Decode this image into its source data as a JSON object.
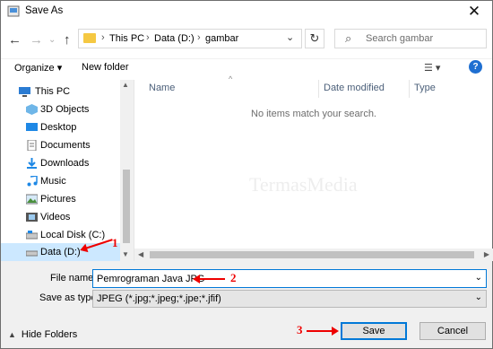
{
  "window": {
    "title": "Save As",
    "close_symbol": "✕"
  },
  "nav": {
    "back": "←",
    "forward": "→",
    "recent": "⌄",
    "up": "↑",
    "path": [
      "This PC",
      "Data (D:)",
      "gambar"
    ],
    "separator": "›",
    "refresh": "↻",
    "search_placeholder": "Search gambar"
  },
  "toolbar": {
    "organize": "Organize ▾",
    "new_folder": "New folder",
    "view": "☰ ▾",
    "help": "?"
  },
  "tree": [
    {
      "label": "This PC",
      "icon": "pc-icon"
    },
    {
      "label": "3D Objects",
      "icon": "3d-objects-icon"
    },
    {
      "label": "Desktop",
      "icon": "desktop-icon"
    },
    {
      "label": "Documents",
      "icon": "documents-icon"
    },
    {
      "label": "Downloads",
      "icon": "downloads-icon"
    },
    {
      "label": "Music",
      "icon": "music-icon"
    },
    {
      "label": "Pictures",
      "icon": "pictures-icon"
    },
    {
      "label": "Videos",
      "icon": "videos-icon"
    },
    {
      "label": "Local Disk (C:)",
      "icon": "drive-icon"
    },
    {
      "label": "Data (D:)",
      "icon": "drive-icon",
      "selected": true
    }
  ],
  "columns": [
    "Name",
    "Date modified",
    "Type"
  ],
  "empty_message": "No items match your search.",
  "watermark": "TermasMedia",
  "form": {
    "file_name_label": "File name:",
    "file_name_value": "Pemrograman Java JPG",
    "save_type_label": "Save as type:",
    "save_type_value": "JPEG (*.jpg;*.jpeg;*.jpe;*.jfif)",
    "hide_folders": "Hide Folders",
    "save": "Save",
    "cancel": "Cancel"
  },
  "annotations": [
    "1",
    "2",
    "3"
  ],
  "colors": {
    "accent": "#0078d7",
    "selection": "#cce8ff",
    "annotation": "#e00000"
  }
}
